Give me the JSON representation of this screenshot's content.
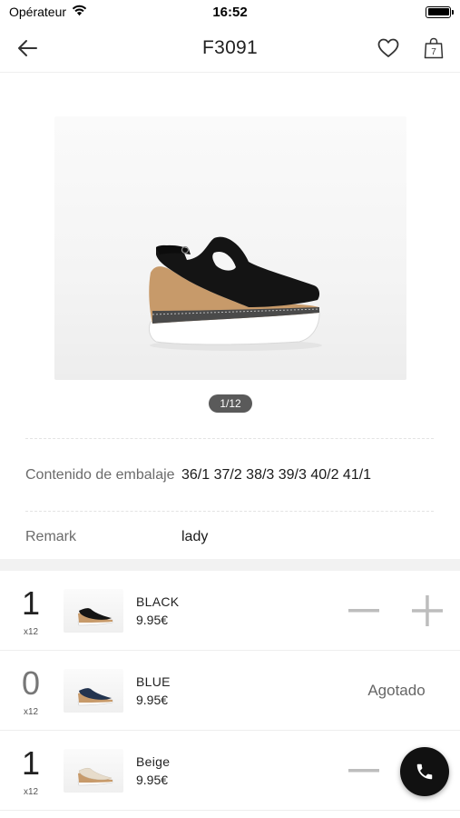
{
  "status_bar": {
    "carrier": "Opérateur",
    "time": "16:52"
  },
  "header": {
    "title": "F3091"
  },
  "cart": {
    "count": "7"
  },
  "gallery": {
    "pager": "1/12"
  },
  "details": [
    {
      "label": "Contenido de embalaje",
      "value": "36/1 37/2 38/3 39/3 40/2 41/1"
    },
    {
      "label": "Remark",
      "value": "lady"
    }
  ],
  "variants": [
    {
      "quantity": "1",
      "pack": "x12",
      "color": "BLACK",
      "price": "9.95€",
      "status": ""
    },
    {
      "quantity": "0",
      "pack": "x12",
      "color": "BLUE",
      "price": "9.95€",
      "status": "Agotado"
    },
    {
      "quantity": "1",
      "pack": "x12",
      "color": "Beige",
      "price": "9.95€",
      "status": ""
    }
  ],
  "colors": {
    "shoe_black": "#111111",
    "shoe_blue": "#23344f",
    "shoe_beige": "#e7dccb",
    "wedge_cork": "#c79a6a",
    "control_gray": "#bdbdbd",
    "fab": "#111111"
  },
  "icons": {
    "back": "arrow-left-icon",
    "favorite": "heart-outline-icon",
    "cart": "shopping-bag-icon",
    "call": "phone-icon"
  }
}
